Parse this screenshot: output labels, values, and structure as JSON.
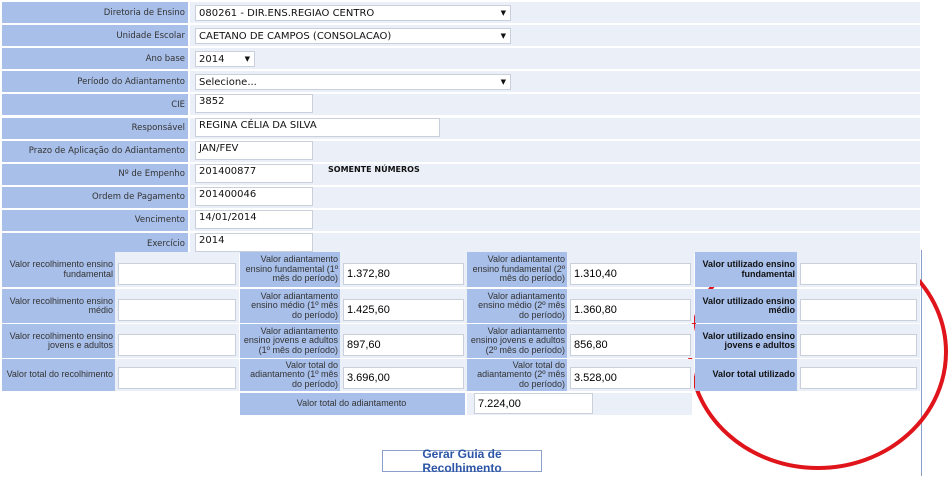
{
  "form": {
    "rows": [
      {
        "label": "Diretoria de Ensino",
        "value": "080261 - DIR.ENS.REGIAO CENTRO",
        "type": "select"
      },
      {
        "label": "Unidade Escolar",
        "value": "CAETANO DE CAMPOS (CONSOLACAO)",
        "type": "select"
      },
      {
        "label": "Ano base",
        "value": "2014",
        "type": "select"
      },
      {
        "label": "Período do Adiantamento",
        "value": "Selecione...",
        "type": "select"
      },
      {
        "label": "CIE",
        "value": "3852",
        "type": "input"
      },
      {
        "label": "Responsável",
        "value": "REGINA CÉLIA DA SILVA",
        "type": "input"
      },
      {
        "label": "Prazo de Aplicação do Adiantamento",
        "value": "JAN/FEV",
        "type": "input"
      },
      {
        "label": "Nº de Empenho",
        "value": "201400877",
        "type": "input"
      },
      {
        "label": "Ordem de Pagamento",
        "value": "201400046",
        "type": "input"
      },
      {
        "label": "Vencimento",
        "value": "14/01/2014",
        "type": "input"
      },
      {
        "label": "Exercício",
        "value": "2014",
        "type": "input"
      }
    ],
    "empenho_hint": "SOMENTE NÚMEROS"
  },
  "grid": {
    "rows": [
      [
        {
          "label": "Valor recolhimento ensino fundamental",
          "value": ""
        },
        {
          "label": "Valor adiantamento ensino fundamental (1º mês do período)",
          "value": "1.372,80"
        },
        {
          "label": "Valor adiantamento ensino fundamental (2º mês do período)",
          "value": "1.310,40"
        },
        {
          "label": "Valor utilizado ensino fundamental",
          "value": ""
        }
      ],
      [
        {
          "label": "Valor recolhimento ensino médio",
          "value": ""
        },
        {
          "label": "Valor adiantamento ensino médio (1º mês do período)",
          "value": "1.425,60"
        },
        {
          "label": "Valor adiantamento ensino médio (2º mês do período)",
          "value": "1.360,80"
        },
        {
          "label": "Valor utilizado ensino médio",
          "value": ""
        }
      ],
      [
        {
          "label": "Valor recolhimento ensino jovens e adultos",
          "value": ""
        },
        {
          "label": "Valor adiantamento ensino jovens e adultos (1º mês do período)",
          "value": "897,60"
        },
        {
          "label": "Valor adiantamento ensino jovens e adultos (2º mês do período)",
          "value": "856,80"
        },
        {
          "label": "Valor utilizado ensino jovens e adultos",
          "value": ""
        }
      ],
      [
        {
          "label": "Valor total do recolhimento",
          "value": ""
        },
        {
          "label": "Valor total do adiantamento (1º mês do período)",
          "value": "3.696,00"
        },
        {
          "label": "Valor total do adiantamento (2º mês do período)",
          "value": "3.528,00"
        },
        {
          "label": "Valor total utilizado",
          "value": ""
        }
      ]
    ],
    "total_label": "Valor total do adiantamento",
    "total_value": "7.224,00"
  },
  "button": {
    "label": "Gerar Guia de Recolhimento"
  },
  "annotation": {
    "color": "#e0151b",
    "shape": "ellipse"
  },
  "colors": {
    "label_bg": "#a8bfe9",
    "value_bg": "#eaeff8",
    "button_text": "#2c55a5"
  }
}
